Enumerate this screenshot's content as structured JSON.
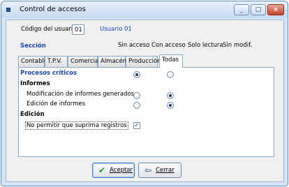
{
  "window": {
    "title": "Control de accesos",
    "minimize": "_",
    "maximize": "□",
    "close": "×"
  },
  "form": {
    "user_code_label": "Código del usuario",
    "user_code_value": "01",
    "user_name": "Usuario 01"
  },
  "section_header": {
    "label": "Sección",
    "col1": "Sin acceso",
    "col2": "Con acceso",
    "col3": "Solo lectura",
    "col4": "Sin modif."
  },
  "tabs": [
    {
      "label": "Contable"
    },
    {
      "label": "T.P.V."
    },
    {
      "label": "Comercial"
    },
    {
      "label": "Almacén"
    },
    {
      "label": "Producción"
    },
    {
      "label": "Todas"
    }
  ],
  "panel": {
    "procesos": {
      "label": "Procesos críticos",
      "col1": true,
      "col2": false
    },
    "informes": {
      "heading": "Informes"
    },
    "mod_informes": {
      "label": "Modificación de informes generados",
      "col1": false,
      "col2": true
    },
    "edit_informes": {
      "label": "Edición de informes",
      "col1": false,
      "col2": true
    },
    "edicion": {
      "heading": "Edición"
    },
    "no_suprimir": {
      "label": "No permitir que suprima registros",
      "checked": true
    }
  },
  "buttons": {
    "accept": "Aceptar",
    "close": "Cerrar"
  },
  "colors": {
    "accent": "#1d43b0",
    "check_icon": "#2e8b2e",
    "close_icon": "#2d4e7e"
  }
}
